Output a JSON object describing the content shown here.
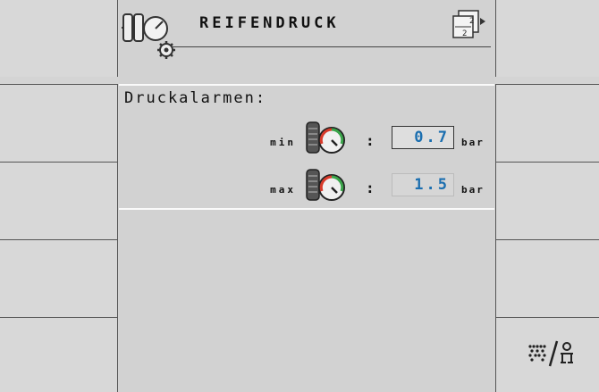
{
  "header": {
    "title": "REIFENDRUCK",
    "page_indicator": {
      "current": "2",
      "total": "2"
    },
    "icon": "tire-pressure-settings-icon"
  },
  "section": {
    "label": "Druckalarmen:"
  },
  "rows": [
    {
      "label": "min",
      "value": "0.7",
      "unit": "bar",
      "icon": "tire-pressure-gauge-icon"
    },
    {
      "label": "max",
      "value": "1.5",
      "unit": "bar",
      "icon": "tire-pressure-gauge-icon"
    }
  ],
  "softkeys": {
    "right_5_icon": "unit-toggle-icon"
  },
  "colors": {
    "background": "#d4d4d4",
    "value_text": "#1c6fb0",
    "gauge_red": "#d83a2a",
    "gauge_green": "#3aa54a"
  }
}
